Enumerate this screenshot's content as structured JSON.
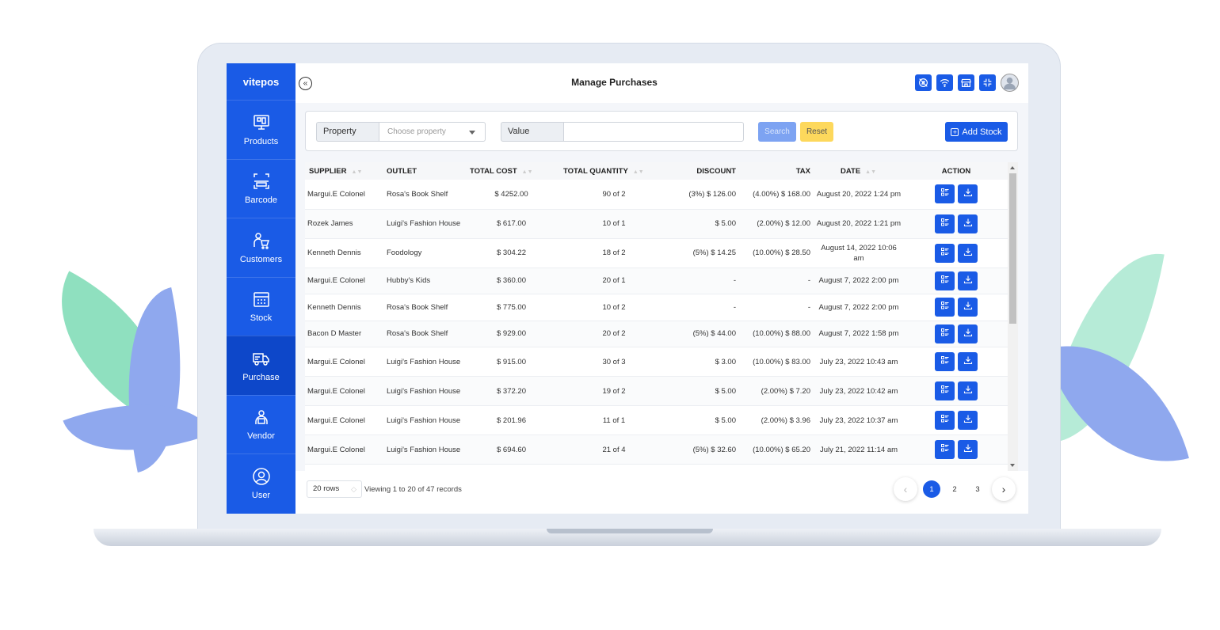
{
  "app": {
    "brand": "vitepos",
    "page_title": "Manage Purchases"
  },
  "sidebar": {
    "items": [
      {
        "label": "Products",
        "icon": "products-icon"
      },
      {
        "label": "Barcode",
        "icon": "barcode-scan-icon"
      },
      {
        "label": "Customers",
        "icon": "customer-cart-icon"
      },
      {
        "label": "Stock",
        "icon": "stock-calendar-icon"
      },
      {
        "label": "Purchase",
        "icon": "truck-icon",
        "active": true
      },
      {
        "label": "Vendor",
        "icon": "vendor-icon"
      },
      {
        "label": "User",
        "icon": "user-circle-icon"
      }
    ]
  },
  "filters": {
    "property_label": "Property",
    "property_placeholder": "Choose property",
    "value_label": "Value",
    "value_text": "",
    "search_label": "Search",
    "reset_label": "Reset",
    "add_stock_label": "Add Stock"
  },
  "table": {
    "headers": [
      "SUPPLIER",
      "OUTLET",
      "TOTAL COST",
      "TOTAL QUANTITY",
      "DISCOUNT",
      "TAX",
      "DATE",
      "ACTION"
    ],
    "rows": [
      {
        "supplier": "Margui.E Colonel",
        "outlet": "Rosa's Book Shelf",
        "cost": "$ 4252.00",
        "qty": "90 of 2",
        "discount": "(3%) $ 126.00",
        "tax": "(4.00%) $ 168.00",
        "date": "August 20, 2022 1:24 pm"
      },
      {
        "supplier": "Rozek James",
        "outlet": "Luigi's Fashion House",
        "cost": "$ 617.00",
        "qty": "10 of 1",
        "discount": "$ 5.00",
        "tax": "(2.00%) $ 12.00",
        "date": "August 20, 2022 1:21 pm"
      },
      {
        "supplier": "Kenneth Dennis",
        "outlet": "Foodology",
        "cost": "$ 304.22",
        "qty": "18 of 2",
        "discount": "(5%) $ 14.25",
        "tax": "(10.00%) $ 28.50",
        "date": "August 14, 2022 10:06 am"
      },
      {
        "supplier": "Margui.E Colonel",
        "outlet": "Hubby's Kids",
        "cost": "$ 360.00",
        "qty": "20 of 1",
        "discount": "-",
        "tax": "-",
        "date": "August 7, 2022 2:00 pm"
      },
      {
        "supplier": "Kenneth Dennis",
        "outlet": "Rosa's Book Shelf",
        "cost": "$ 775.00",
        "qty": "10 of 2",
        "discount": "-",
        "tax": "-",
        "date": "August 7, 2022 2:00 pm"
      },
      {
        "supplier": "Bacon D Master",
        "outlet": "Rosa's Book Shelf",
        "cost": "$ 929.00",
        "qty": "20 of 2",
        "discount": "(5%) $ 44.00",
        "tax": "(10.00%) $ 88.00",
        "date": "August 7, 2022 1:58 pm"
      },
      {
        "supplier": "Margui.E Colonel",
        "outlet": "Luigi's Fashion House",
        "cost": "$ 915.00",
        "qty": "30 of 3",
        "discount": "$ 3.00",
        "tax": "(10.00%) $ 83.00",
        "date": "July 23, 2022 10:43 am"
      },
      {
        "supplier": "Margui.E Colonel",
        "outlet": "Luigi's Fashion House",
        "cost": "$ 372.20",
        "qty": "19 of 2",
        "discount": "$ 5.00",
        "tax": "(2.00%) $ 7.20",
        "date": "July 23, 2022 10:42 am"
      },
      {
        "supplier": "Margui.E Colonel",
        "outlet": "Luigi's Fashion House",
        "cost": "$ 201.96",
        "qty": "11 of 1",
        "discount": "$ 5.00",
        "tax": "(2.00%) $ 3.96",
        "date": "July 23, 2022 10:37 am"
      },
      {
        "supplier": "Margui.E Colonel",
        "outlet": "Luigi's Fashion House",
        "cost": "$ 694.60",
        "qty": "21 of 4",
        "discount": "(5%) $ 32.60",
        "tax": "(10.00%) $ 65.20",
        "date": "July 21, 2022 11:14 am"
      }
    ]
  },
  "footer": {
    "rows_per_page": "20 rows",
    "viewing_text": "Viewing 1 to 20 of 47 records",
    "prev_symbol": "‹",
    "next_symbol": "›",
    "pages": [
      "1",
      "2",
      "3"
    ],
    "current_page": "1"
  },
  "colors": {
    "primary": "#1a5be6",
    "reset": "#fdd85c",
    "search_disabled": "#7da3f2"
  }
}
